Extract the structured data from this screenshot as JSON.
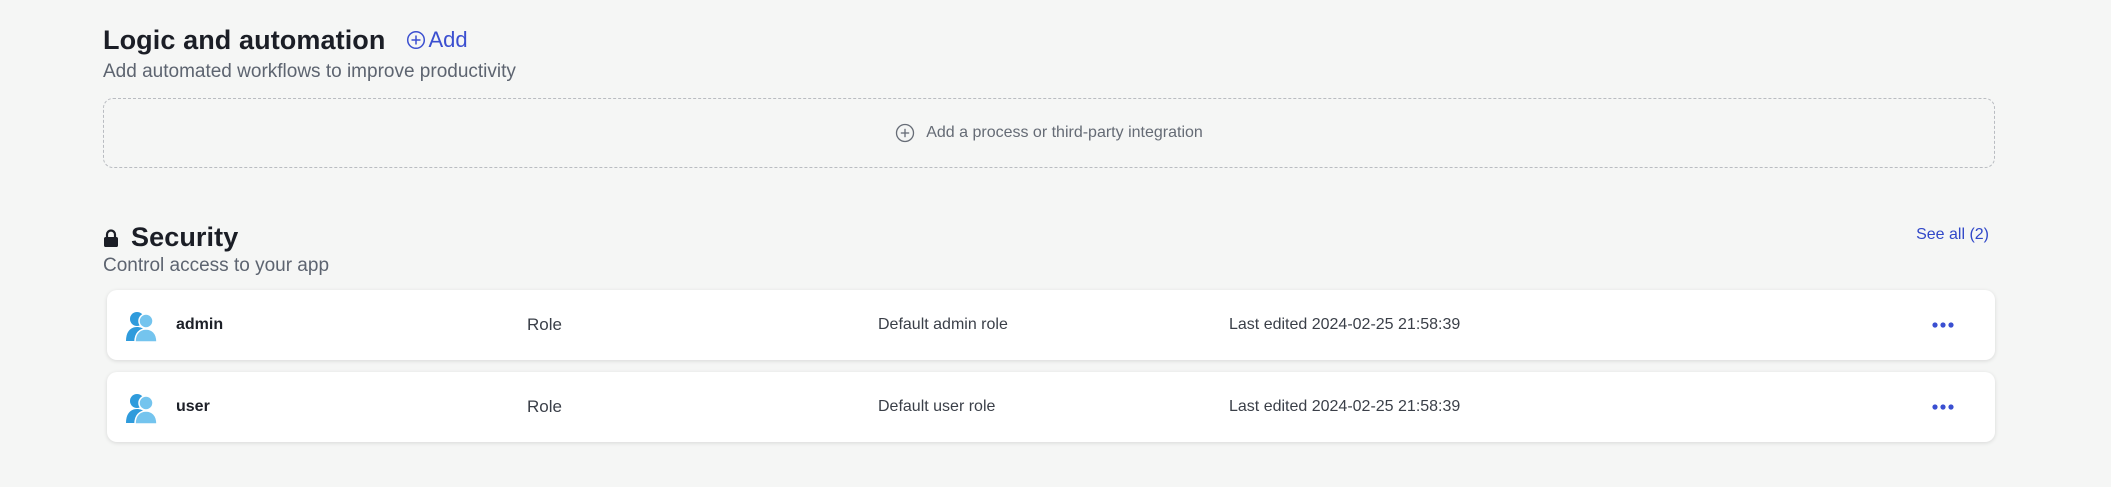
{
  "logic": {
    "title": "Logic and automation",
    "add_label": "Add",
    "subtitle": "Add automated workflows to improve productivity",
    "empty_action_label": "Add a process or third-party integration"
  },
  "security": {
    "title": "Security",
    "subtitle": "Control access to your app",
    "see_all_label": "See all (2)",
    "roles": [
      {
        "name": "admin",
        "type": "Role",
        "description": "Default admin role",
        "last_edited": "Last edited 2024-02-25 21:58:39",
        "icon": "users-icon"
      },
      {
        "name": "user",
        "type": "Role",
        "description": "Default user role",
        "last_edited": "Last edited 2024-02-25 21:58:39",
        "icon": "users-icon"
      }
    ]
  },
  "colors": {
    "background": "#f5f6f5",
    "accent": "#3b4fd0",
    "avatar": "#2f9bdc",
    "card": "#ffffff"
  }
}
